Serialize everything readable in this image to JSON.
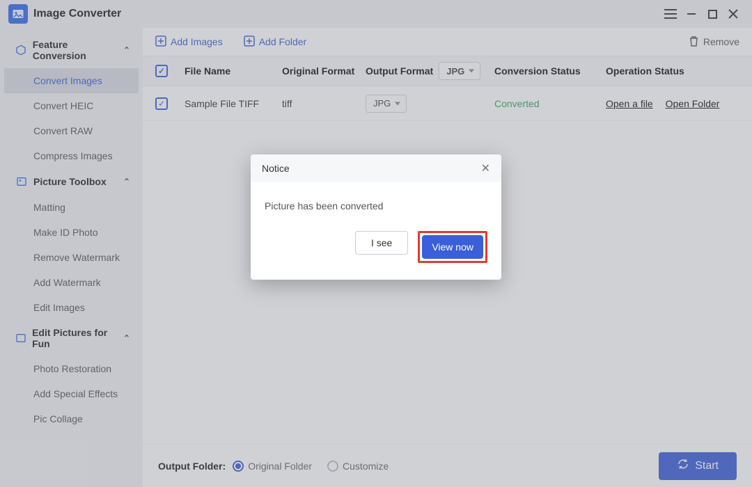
{
  "titlebar": {
    "title": "Image Converter"
  },
  "sidebar": {
    "sections": [
      {
        "label": "Feature Conversion",
        "items": [
          {
            "label": "Convert Images",
            "active": true
          },
          {
            "label": "Convert HEIC"
          },
          {
            "label": "Convert RAW"
          },
          {
            "label": "Compress Images"
          }
        ]
      },
      {
        "label": "Picture Toolbox",
        "items": [
          {
            "label": "Matting"
          },
          {
            "label": "Make ID Photo"
          },
          {
            "label": "Remove Watermark"
          },
          {
            "label": "Add Watermark"
          },
          {
            "label": "Edit Images"
          }
        ]
      },
      {
        "label": "Edit Pictures for Fun",
        "items": [
          {
            "label": "Photo Restoration"
          },
          {
            "label": "Add Special Effects"
          },
          {
            "label": "Pic Collage"
          }
        ]
      }
    ]
  },
  "toolbar": {
    "add_images": "Add Images",
    "add_folder": "Add Folder",
    "remove": "Remove"
  },
  "table": {
    "headers": {
      "file_name": "File Name",
      "original_format": "Original Format",
      "output_format": "Output Format",
      "output_select": "JPG",
      "conversion_status": "Conversion Status",
      "operation_status": "Operation Status"
    },
    "rows": [
      {
        "file_name": "Sample File TIFF",
        "original_format": "tiff",
        "output_format": "JPG",
        "conversion_status": "Converted",
        "op_open_file": "Open a file",
        "op_open_folder": "Open Folder"
      }
    ]
  },
  "footer": {
    "label": "Output Folder:",
    "original": "Original Folder",
    "customize": "Customize",
    "start": "Start"
  },
  "modal": {
    "title": "Notice",
    "message": "Picture has been converted",
    "secondary": "I see",
    "primary": "View now"
  }
}
